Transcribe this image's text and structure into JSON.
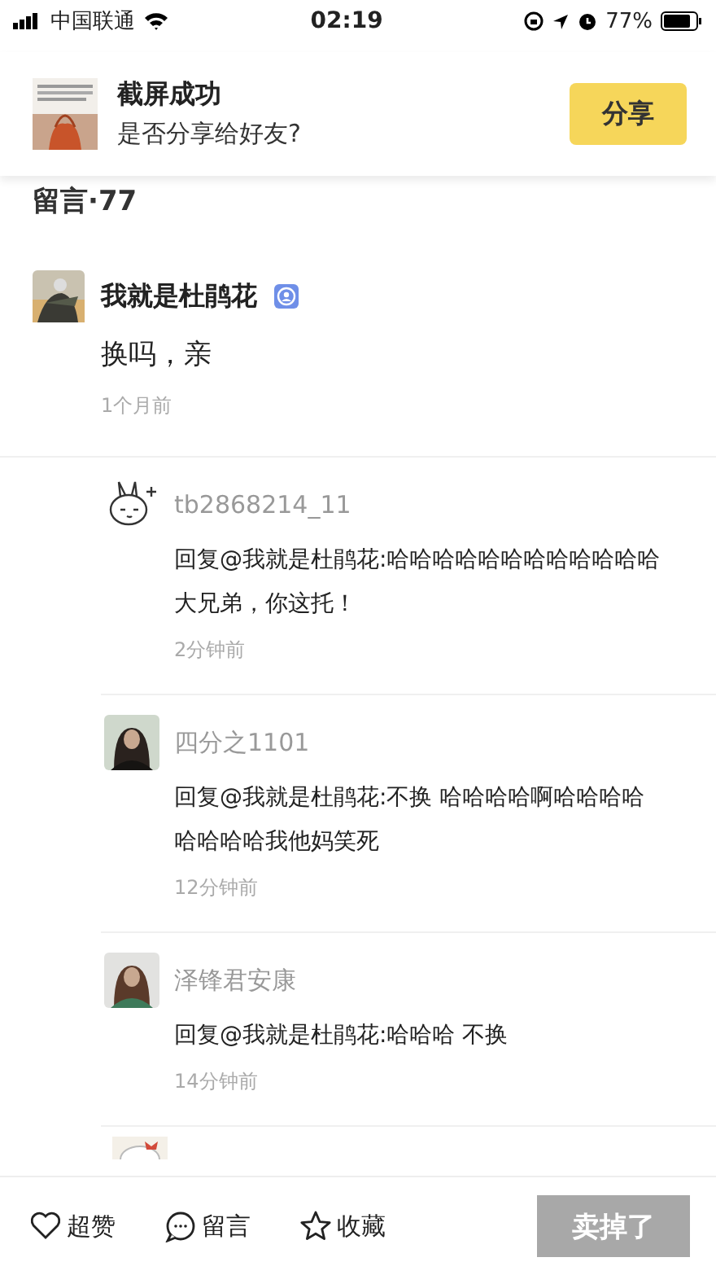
{
  "status_bar": {
    "carrier": "中国联通",
    "time": "02:19",
    "battery": "77%"
  },
  "notification": {
    "title": "截屏成功",
    "subtitle": "是否分享给好友?",
    "button": "分享"
  },
  "section_title": "留言·77",
  "comment": {
    "name": "我就是杜鹃花",
    "verified": true,
    "text": "换吗，亲",
    "time": "1个月前",
    "replies": [
      {
        "name": "tb2868214_11",
        "text": "回复@我就是杜鹃花:哈哈哈哈哈哈哈哈哈哈哈哈大兄弟，你这托！",
        "time": "2分钟前"
      },
      {
        "name": "四分之1101",
        "text": "回复@我就是杜鹃花:不换 哈哈哈哈啊哈哈哈哈哈哈哈哈我他妈笑死",
        "time": "12分钟前"
      },
      {
        "name": "泽锋君安康",
        "text": "回复@我就是杜鹃花:哈哈哈  不换",
        "time": "14分钟前"
      }
    ]
  },
  "bottom_bar": {
    "actions": [
      {
        "kind": "like",
        "label": "超赞"
      },
      {
        "kind": "comment",
        "label": "留言"
      },
      {
        "kind": "favorite",
        "label": "收藏"
      }
    ],
    "sell_button": {
      "label": "卖掉了",
      "disabled": true
    }
  }
}
